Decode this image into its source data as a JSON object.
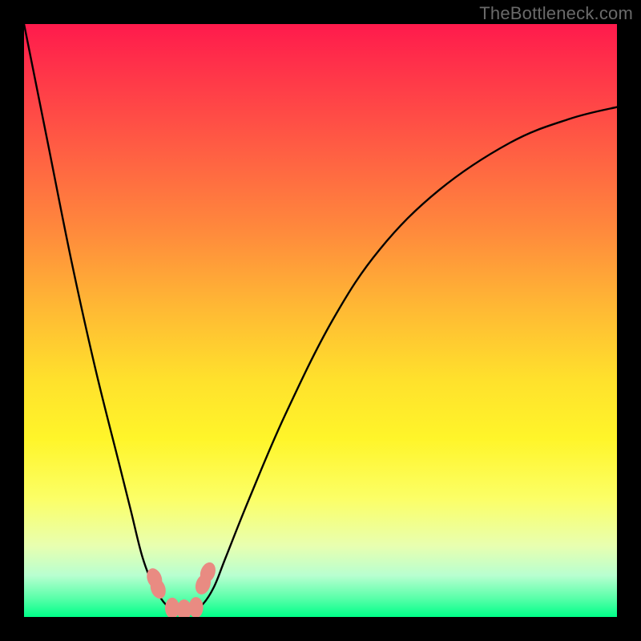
{
  "watermark": "TheBottleneck.com",
  "chart_data": {
    "type": "line",
    "title": "",
    "xlabel": "",
    "ylabel": "",
    "xlim": [
      0,
      100
    ],
    "ylim": [
      0,
      100
    ],
    "background_gradient": [
      "#ff1a4c",
      "#ffe12c",
      "#00ff88"
    ],
    "series": [
      {
        "name": "bottleneck-curve",
        "x": [
          0,
          4,
          8,
          12,
          16,
          18,
          20,
          22,
          24,
          26,
          27,
          28,
          30,
          32,
          34,
          38,
          44,
          52,
          60,
          70,
          82,
          92,
          100
        ],
        "values": [
          100,
          80,
          60,
          42,
          26,
          18,
          10,
          5,
          2,
          1,
          1,
          1,
          2,
          5,
          10,
          20,
          34,
          50,
          62,
          72,
          80,
          84,
          86
        ]
      }
    ],
    "markers": [
      {
        "name": "left-marker-upper",
        "x": 22.0,
        "y": 6.5
      },
      {
        "name": "left-marker-lower",
        "x": 22.6,
        "y": 4.8
      },
      {
        "name": "right-marker-upper",
        "x": 31.0,
        "y": 7.5
      },
      {
        "name": "right-marker-lower",
        "x": 30.2,
        "y": 5.5
      },
      {
        "name": "bottom-marker-1",
        "x": 25.0,
        "y": 1.5
      },
      {
        "name": "bottom-marker-2",
        "x": 27.0,
        "y": 1.2
      },
      {
        "name": "bottom-marker-3",
        "x": 29.0,
        "y": 1.6
      }
    ],
    "marker_color": "#e98b82"
  }
}
